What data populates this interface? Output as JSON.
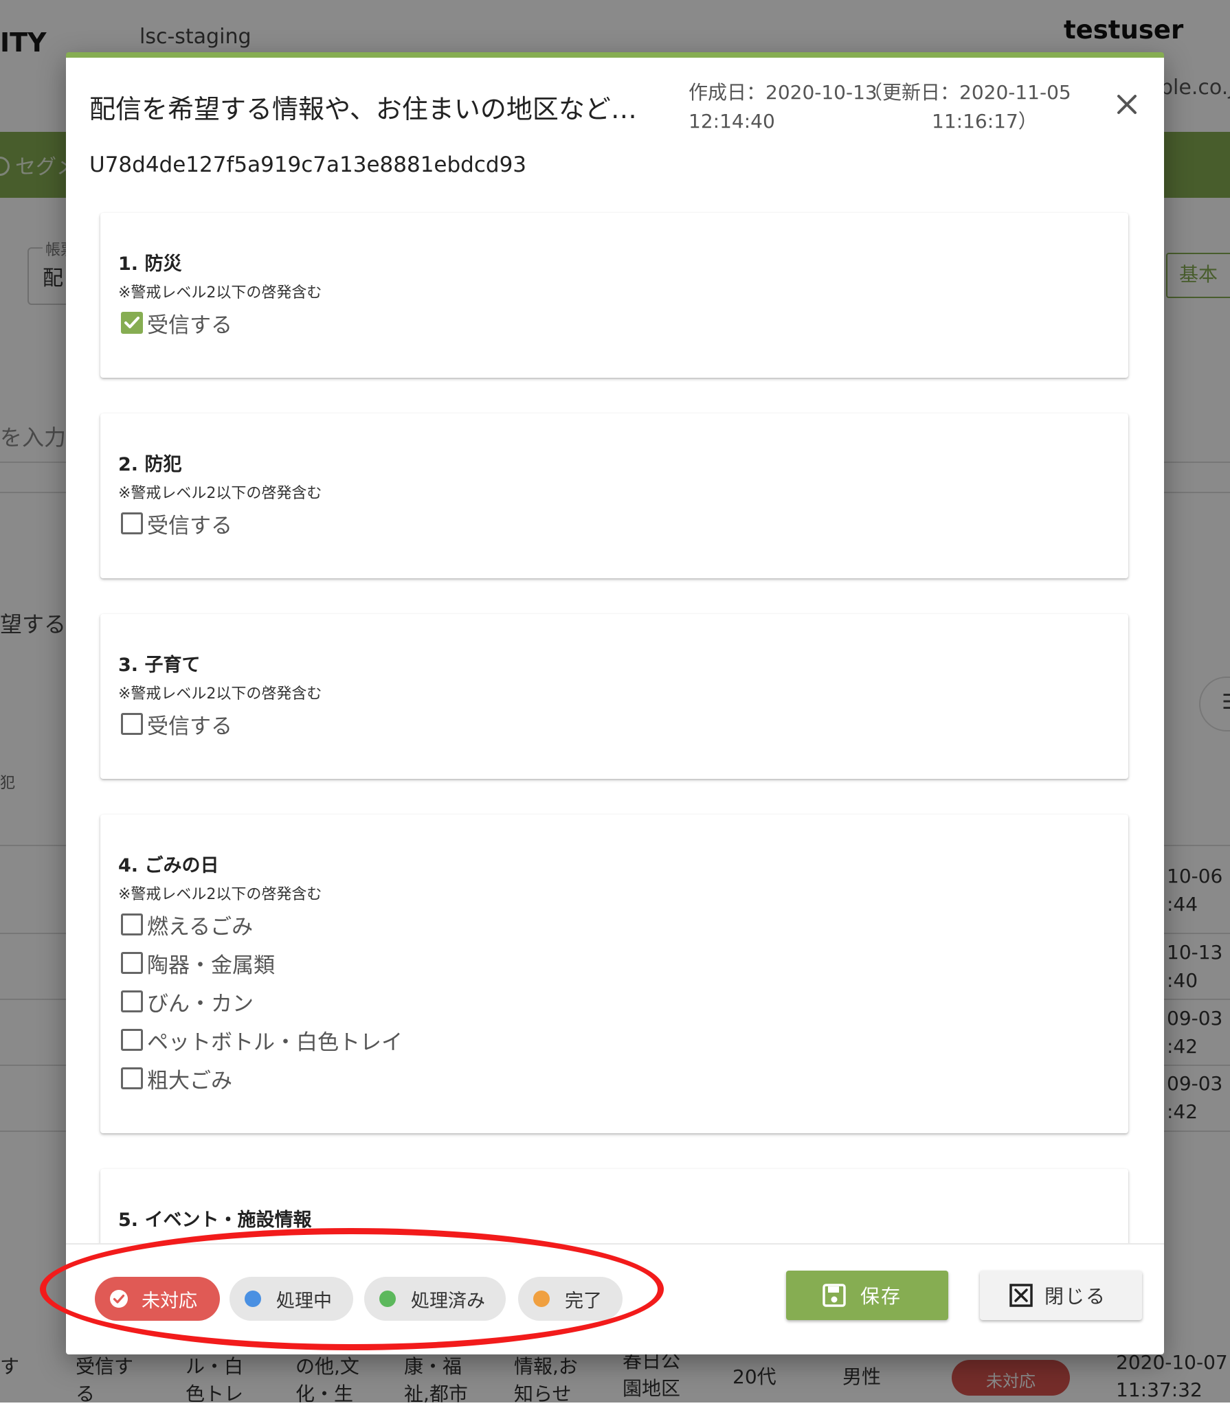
{
  "background": {
    "logo": "ITY",
    "environment": "lsc-staging",
    "username": "testuser",
    "domain_fragment": "ple.co.jp",
    "segment_label": "セグメ",
    "form_legend": "帳票",
    "form_value": "配",
    "basic_button": "基本",
    "input_hint": "を入力",
    "text_fragment_1": "望する情",
    "text_fragment_2": "犯",
    "fab_icon": "menu-icon",
    "time_fragments": [
      {
        "date": "10-06",
        "time": ":44"
      },
      {
        "date": "10-13",
        "time": ":40"
      },
      {
        "date": "09-03",
        "time": ":42"
      },
      {
        "date": "09-03",
        "time": ":42"
      }
    ],
    "bottom_row": {
      "col1": "す",
      "col2": "受信す\nる",
      "col3": "ル・白\n色トレ",
      "col4": "の他,文\n化・生",
      "col5": "康・福\n祉,都市",
      "col6": "急案告\n情報,お\n知らせ",
      "col7": "春日公\n園地区",
      "age": "20代",
      "gender": "男性",
      "status": "未対応",
      "datetime": "2020-10-07\n11:37:32"
    }
  },
  "dialog": {
    "title": "配信を希望する情報や、お住まいの地区など…",
    "created_label": "作成日：2020-10-13",
    "created_time": "12:14:40",
    "updated_label": "（更新日：2020-11-05",
    "updated_time": "11:16:17）",
    "user_id": "U78d4de127f5a919c7a13e8881ebdcd93",
    "questions": [
      {
        "title": "1. 防災",
        "note": "※警戒レベル2以下の啓発含む",
        "options": [
          {
            "label": "受信する",
            "checked": true
          }
        ]
      },
      {
        "title": "2. 防犯",
        "note": "※警戒レベル2以下の啓発含む",
        "options": [
          {
            "label": "受信する",
            "checked": false
          }
        ]
      },
      {
        "title": "3. 子育て",
        "note": "※警戒レベル2以下の啓発含む",
        "options": [
          {
            "label": "受信する",
            "checked": false
          }
        ]
      },
      {
        "title": "4. ごみの日",
        "note": "※警戒レベル2以下の啓発含む",
        "options": [
          {
            "label": "燃えるごみ",
            "checked": false
          },
          {
            "label": "陶器・金属類",
            "checked": false
          },
          {
            "label": "びん・カン",
            "checked": false
          },
          {
            "label": "ペットボトル・白色トレイ",
            "checked": false
          },
          {
            "label": "粗大ごみ",
            "checked": false
          }
        ]
      },
      {
        "title": "5. イベント・施設情報"
      }
    ],
    "status_chips": [
      {
        "label": "未対応",
        "color": "#e05a55",
        "active": true
      },
      {
        "label": "処理中",
        "color": "#4a90e2",
        "active": false
      },
      {
        "label": "処理済み",
        "color": "#5cb85c",
        "active": false
      },
      {
        "label": "完了",
        "color": "#f0a040",
        "active": false
      }
    ],
    "save_button": "保存",
    "close_button": "閉じる",
    "icons": {
      "close": "close-icon",
      "save": "save-icon",
      "close_box": "close-box-icon",
      "check": "check-circle-icon"
    }
  },
  "colors": {
    "accent": "#86ad52",
    "annotation": "#f21b1b"
  }
}
